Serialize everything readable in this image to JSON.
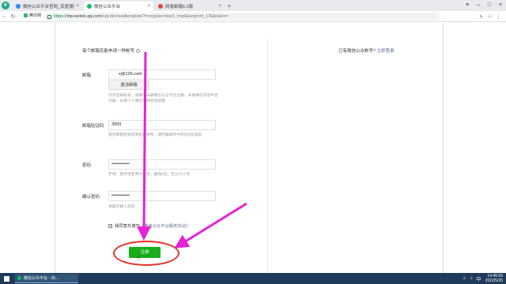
{
  "browser": {
    "tabs": [
      {
        "title": "微信公众平台官网_百度搜索",
        "active": false,
        "favicon": "baidu-icon"
      },
      {
        "title": "微信公众平台",
        "active": true,
        "favicon": "wechat-icon"
      },
      {
        "title": "网易邮箱6.0版",
        "active": false,
        "favicon": "netease-mail-icon"
      }
    ],
    "new_tab": "+",
    "address": {
      "scheme": "https://",
      "host": "mp.weixin.qq.com",
      "path": "/cgi-bin/readtemplate?t=register/step1_tmpl&lang=zh_CN&token="
    },
    "bookmark": "腾讯网"
  },
  "form": {
    "intro": "每个邮箱仅能申请一种帐号",
    "login_prompt": "已有微信公众帐号?",
    "login_link": "立即登录",
    "email": {
      "label": "邮箱",
      "value": "      x@126.com",
      "activate_button": "激活邮箱",
      "hint": "作为登录帐号，请填写未被微信公众平台注册，未被微信开放平台注册，未被个人微信号绑定的邮箱"
    },
    "code": {
      "label": "邮箱验证码",
      "value": "3993",
      "hint": "激活邮箱后将收到验证邮件，请回填邮件中的6位验证码"
    },
    "password": {
      "label": "密码",
      "value": "••••••••••••",
      "hint": "字母、数字或者英文符号，最短8位，区分大小写"
    },
    "confirm": {
      "label": "确认密码",
      "value": "••••••••••••",
      "hint": "请再次输入密码"
    },
    "agree": {
      "checked": "✓",
      "text": "我同意并遵守",
      "link": "《微信公众平台服务协议》"
    },
    "register_button": "注册"
  },
  "taskbar": {
    "task": "微信公众平台 - 36...",
    "time": "14:45:59",
    "date": "2022/5/26",
    "language": "中"
  },
  "colors": {
    "primary": "#1aad19",
    "link": "#576b95",
    "annotation_arrow": "#e622d6",
    "annotation_circle": "#e8312a"
  }
}
